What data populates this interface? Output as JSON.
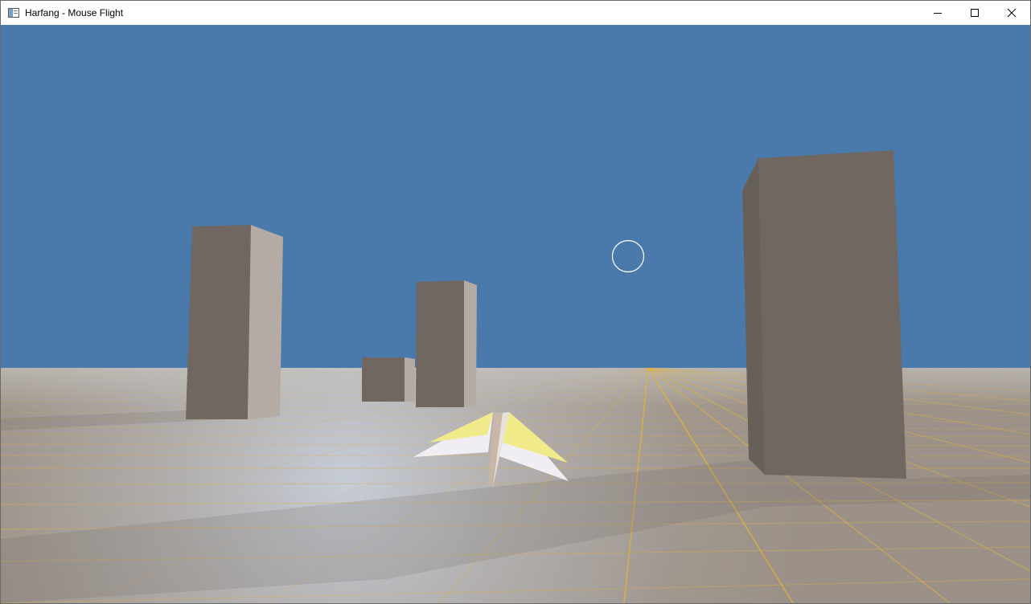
{
  "window": {
    "title": "Harfang - Mouse Flight",
    "app_icon": "window-app-icon",
    "controls": {
      "minimize": "minimize-icon",
      "maximize": "maximize-icon",
      "close": "close-icon"
    }
  },
  "scene": {
    "sky_color": "#4a7aac",
    "ground_color": "#a59d94",
    "grid_color": "#e0b040",
    "building_dark": "#6f6760",
    "building_light": "#b0a8a0",
    "plane_white": "#f0eef2",
    "plane_yellow": "#f1ea8a",
    "reticle_color": "#ffffff"
  }
}
